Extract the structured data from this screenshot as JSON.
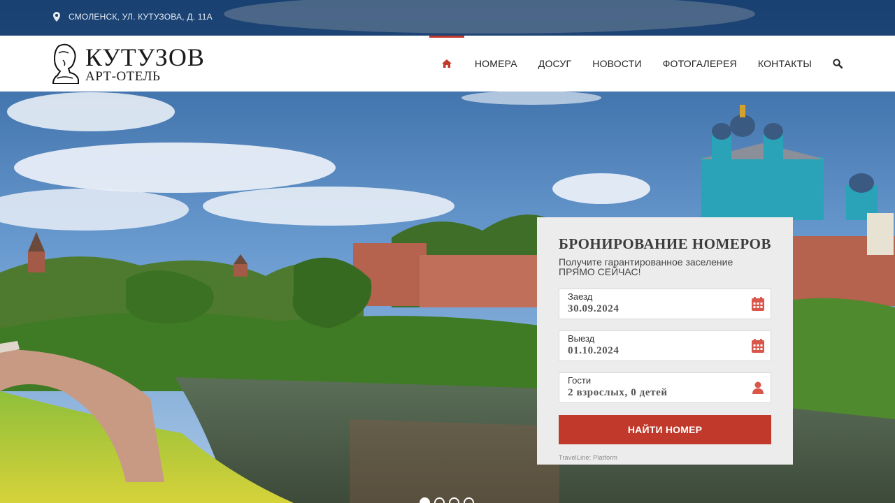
{
  "topbar": {
    "address": "СМОЛЕНСК, УЛ. КУТУЗОВА, Д. 11А",
    "icon": "map-marker-icon"
  },
  "logo": {
    "title": "КУТУЗОВ",
    "subtitle": "АРТ-ОТЕЛЬ"
  },
  "nav": {
    "home_icon": "home-icon",
    "items": [
      {
        "label": "НОМЕРА"
      },
      {
        "label": "ДОСУГ"
      },
      {
        "label": "НОВОСТИ"
      },
      {
        "label": "ФОТОГАЛЕРЕЯ"
      },
      {
        "label": "КОНТАКТЫ"
      }
    ],
    "search_icon": "search-icon"
  },
  "booking": {
    "title": "БРОНИРОВАНИЕ НОМЕРОВ",
    "subtitle_line1": "Получите гарантированное заселение",
    "subtitle_line2": "ПРЯМО СЕЙЧАС!",
    "checkin_label": "Заезд",
    "checkin_value": "30.09.2024",
    "checkout_label": "Выезд",
    "checkout_value": "01.10.2024",
    "guests_label": "Гости",
    "guests_value": "2 взрослых, 0 детей",
    "button_label": "НАЙТИ НОМЕР",
    "powered_by": "TravelLine: Platform"
  },
  "slider": {
    "dot_count": 4,
    "active_index": 0
  },
  "colors": {
    "accent": "#c0392b",
    "topbar": "#0a2850",
    "widget_bg": "#ececec"
  }
}
